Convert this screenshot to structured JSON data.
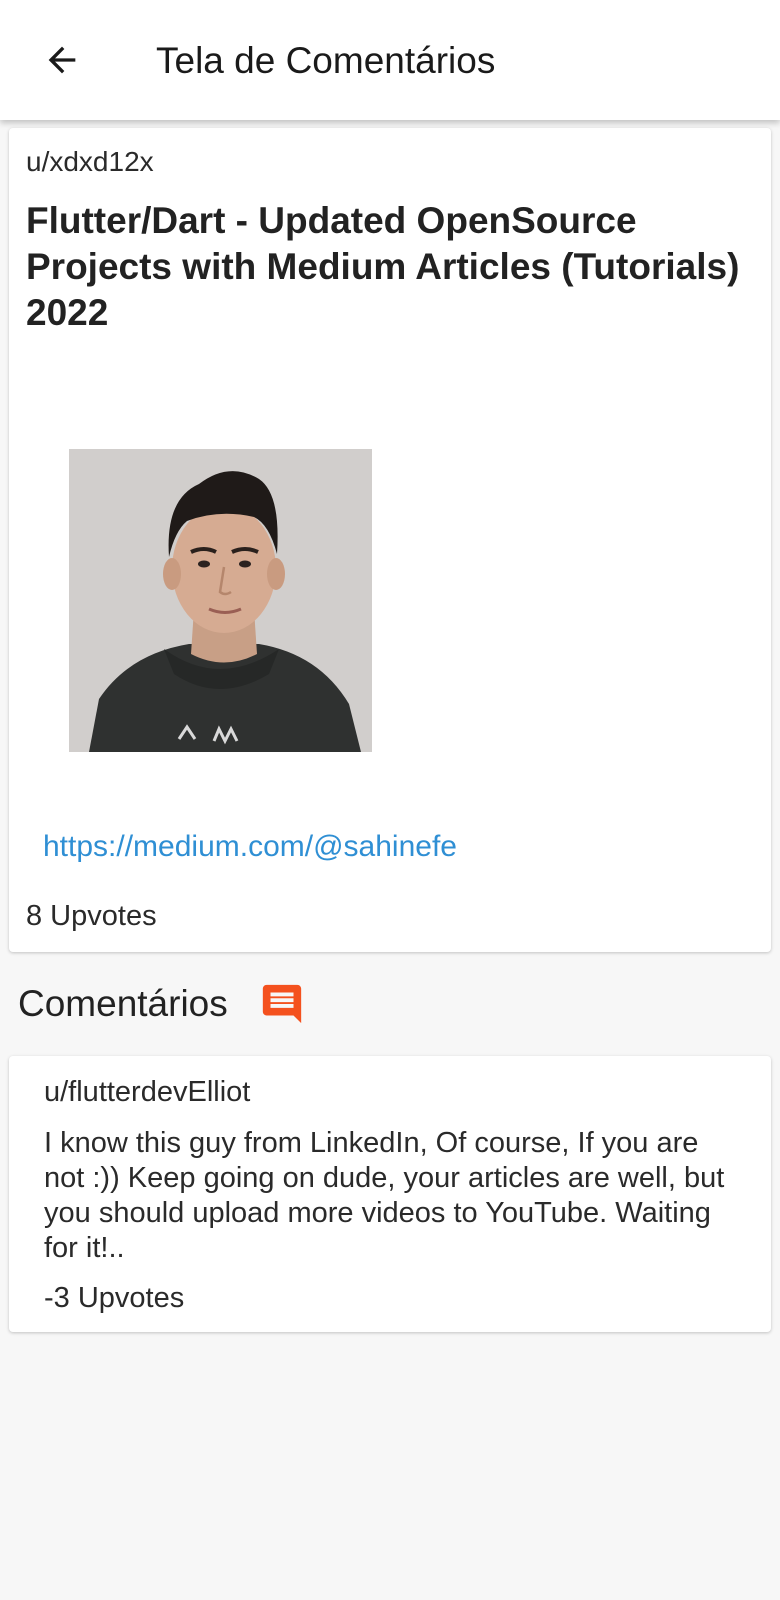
{
  "app_bar": {
    "title": "Tela de Comentários",
    "back_icon": "arrow-left-icon"
  },
  "post": {
    "author": "u/xdxd12x",
    "title": "Flutter/Dart - Updated OpenSource Projects with Medium Articles (Tutorials) 2022",
    "image": "author-photo",
    "link": "https://medium.com/@sahinefe",
    "upvotes": "8 Upvotes"
  },
  "comments_section": {
    "title": "Comentários",
    "icon": "comment-icon",
    "icon_color": "#f4511e"
  },
  "comments": [
    {
      "author": "u/flutterdevElliot",
      "body": "I know this guy from LinkedIn, Of course, If you are not :)) Keep going on dude, your articles are well, but you should upload more videos to YouTube. Waiting for it!..",
      "upvotes": "-3 Upvotes"
    }
  ],
  "colors": {
    "link": "#2f8fd4",
    "background": "#f7f7f7",
    "card": "#ffffff"
  }
}
